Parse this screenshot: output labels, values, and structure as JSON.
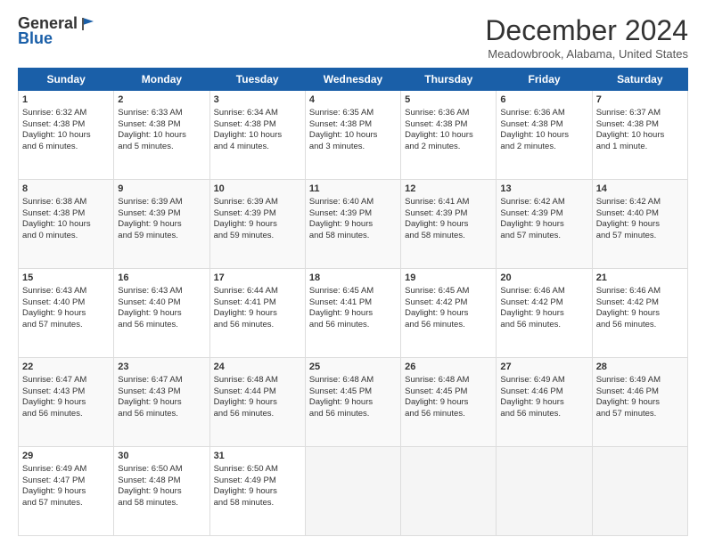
{
  "logo": {
    "line1": "General",
    "line2": "Blue"
  },
  "title": "December 2024",
  "location": "Meadowbrook, Alabama, United States",
  "days_of_week": [
    "Sunday",
    "Monday",
    "Tuesday",
    "Wednesday",
    "Thursday",
    "Friday",
    "Saturday"
  ],
  "weeks": [
    [
      {
        "day": 1,
        "lines": [
          "Sunrise: 6:32 AM",
          "Sunset: 4:38 PM",
          "Daylight: 10 hours",
          "and 6 minutes."
        ]
      },
      {
        "day": 2,
        "lines": [
          "Sunrise: 6:33 AM",
          "Sunset: 4:38 PM",
          "Daylight: 10 hours",
          "and 5 minutes."
        ]
      },
      {
        "day": 3,
        "lines": [
          "Sunrise: 6:34 AM",
          "Sunset: 4:38 PM",
          "Daylight: 10 hours",
          "and 4 minutes."
        ]
      },
      {
        "day": 4,
        "lines": [
          "Sunrise: 6:35 AM",
          "Sunset: 4:38 PM",
          "Daylight: 10 hours",
          "and 3 minutes."
        ]
      },
      {
        "day": 5,
        "lines": [
          "Sunrise: 6:36 AM",
          "Sunset: 4:38 PM",
          "Daylight: 10 hours",
          "and 2 minutes."
        ]
      },
      {
        "day": 6,
        "lines": [
          "Sunrise: 6:36 AM",
          "Sunset: 4:38 PM",
          "Daylight: 10 hours",
          "and 2 minutes."
        ]
      },
      {
        "day": 7,
        "lines": [
          "Sunrise: 6:37 AM",
          "Sunset: 4:38 PM",
          "Daylight: 10 hours",
          "and 1 minute."
        ]
      }
    ],
    [
      {
        "day": 8,
        "lines": [
          "Sunrise: 6:38 AM",
          "Sunset: 4:38 PM",
          "Daylight: 10 hours",
          "and 0 minutes."
        ]
      },
      {
        "day": 9,
        "lines": [
          "Sunrise: 6:39 AM",
          "Sunset: 4:39 PM",
          "Daylight: 9 hours",
          "and 59 minutes."
        ]
      },
      {
        "day": 10,
        "lines": [
          "Sunrise: 6:39 AM",
          "Sunset: 4:39 PM",
          "Daylight: 9 hours",
          "and 59 minutes."
        ]
      },
      {
        "day": 11,
        "lines": [
          "Sunrise: 6:40 AM",
          "Sunset: 4:39 PM",
          "Daylight: 9 hours",
          "and 58 minutes."
        ]
      },
      {
        "day": 12,
        "lines": [
          "Sunrise: 6:41 AM",
          "Sunset: 4:39 PM",
          "Daylight: 9 hours",
          "and 58 minutes."
        ]
      },
      {
        "day": 13,
        "lines": [
          "Sunrise: 6:42 AM",
          "Sunset: 4:39 PM",
          "Daylight: 9 hours",
          "and 57 minutes."
        ]
      },
      {
        "day": 14,
        "lines": [
          "Sunrise: 6:42 AM",
          "Sunset: 4:40 PM",
          "Daylight: 9 hours",
          "and 57 minutes."
        ]
      }
    ],
    [
      {
        "day": 15,
        "lines": [
          "Sunrise: 6:43 AM",
          "Sunset: 4:40 PM",
          "Daylight: 9 hours",
          "and 57 minutes."
        ]
      },
      {
        "day": 16,
        "lines": [
          "Sunrise: 6:43 AM",
          "Sunset: 4:40 PM",
          "Daylight: 9 hours",
          "and 56 minutes."
        ]
      },
      {
        "day": 17,
        "lines": [
          "Sunrise: 6:44 AM",
          "Sunset: 4:41 PM",
          "Daylight: 9 hours",
          "and 56 minutes."
        ]
      },
      {
        "day": 18,
        "lines": [
          "Sunrise: 6:45 AM",
          "Sunset: 4:41 PM",
          "Daylight: 9 hours",
          "and 56 minutes."
        ]
      },
      {
        "day": 19,
        "lines": [
          "Sunrise: 6:45 AM",
          "Sunset: 4:42 PM",
          "Daylight: 9 hours",
          "and 56 minutes."
        ]
      },
      {
        "day": 20,
        "lines": [
          "Sunrise: 6:46 AM",
          "Sunset: 4:42 PM",
          "Daylight: 9 hours",
          "and 56 minutes."
        ]
      },
      {
        "day": 21,
        "lines": [
          "Sunrise: 6:46 AM",
          "Sunset: 4:42 PM",
          "Daylight: 9 hours",
          "and 56 minutes."
        ]
      }
    ],
    [
      {
        "day": 22,
        "lines": [
          "Sunrise: 6:47 AM",
          "Sunset: 4:43 PM",
          "Daylight: 9 hours",
          "and 56 minutes."
        ]
      },
      {
        "day": 23,
        "lines": [
          "Sunrise: 6:47 AM",
          "Sunset: 4:43 PM",
          "Daylight: 9 hours",
          "and 56 minutes."
        ]
      },
      {
        "day": 24,
        "lines": [
          "Sunrise: 6:48 AM",
          "Sunset: 4:44 PM",
          "Daylight: 9 hours",
          "and 56 minutes."
        ]
      },
      {
        "day": 25,
        "lines": [
          "Sunrise: 6:48 AM",
          "Sunset: 4:45 PM",
          "Daylight: 9 hours",
          "and 56 minutes."
        ]
      },
      {
        "day": 26,
        "lines": [
          "Sunrise: 6:48 AM",
          "Sunset: 4:45 PM",
          "Daylight: 9 hours",
          "and 56 minutes."
        ]
      },
      {
        "day": 27,
        "lines": [
          "Sunrise: 6:49 AM",
          "Sunset: 4:46 PM",
          "Daylight: 9 hours",
          "and 56 minutes."
        ]
      },
      {
        "day": 28,
        "lines": [
          "Sunrise: 6:49 AM",
          "Sunset: 4:46 PM",
          "Daylight: 9 hours",
          "and 57 minutes."
        ]
      }
    ],
    [
      {
        "day": 29,
        "lines": [
          "Sunrise: 6:49 AM",
          "Sunset: 4:47 PM",
          "Daylight: 9 hours",
          "and 57 minutes."
        ]
      },
      {
        "day": 30,
        "lines": [
          "Sunrise: 6:50 AM",
          "Sunset: 4:48 PM",
          "Daylight: 9 hours",
          "and 58 minutes."
        ]
      },
      {
        "day": 31,
        "lines": [
          "Sunrise: 6:50 AM",
          "Sunset: 4:49 PM",
          "Daylight: 9 hours",
          "and 58 minutes."
        ]
      },
      null,
      null,
      null,
      null
    ]
  ]
}
